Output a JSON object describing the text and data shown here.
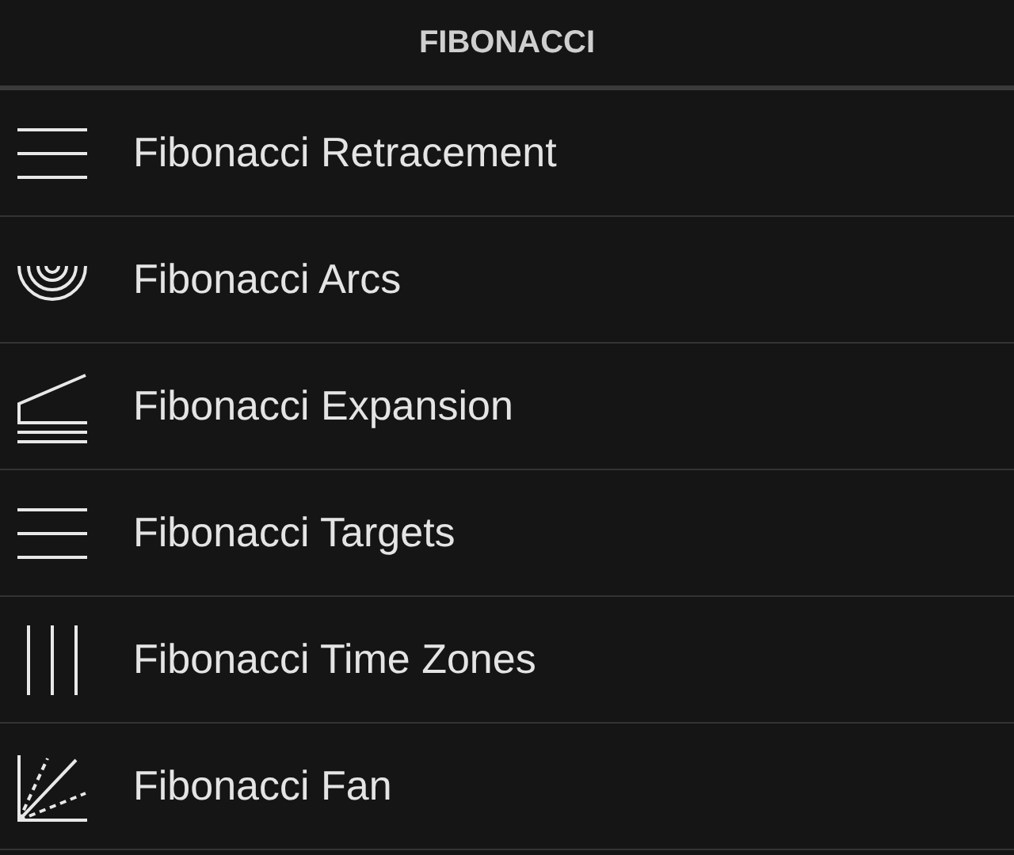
{
  "header": {
    "title": "FIBONACCI"
  },
  "items": [
    {
      "kind": "retracement",
      "label": "Fibonacci Retracement"
    },
    {
      "kind": "arcs",
      "label": "Fibonacci Arcs"
    },
    {
      "kind": "expansion",
      "label": "Fibonacci Expansion"
    },
    {
      "kind": "targets",
      "label": "Fibonacci Targets"
    },
    {
      "kind": "timezones",
      "label": "Fibonacci Time Zones"
    },
    {
      "kind": "fan",
      "label": "Fibonacci Fan"
    }
  ]
}
